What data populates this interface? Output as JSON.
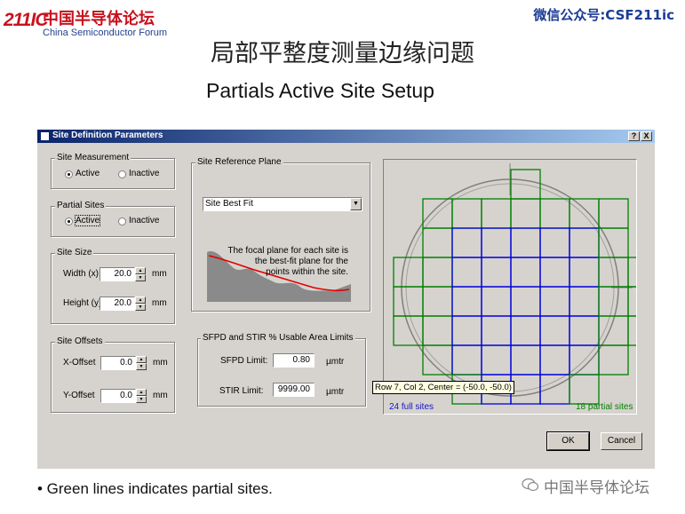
{
  "header": {
    "logo_mark": "211IC",
    "logo_cn": "中国半导体论坛",
    "logo_en": "China Semiconductor Forum",
    "wechat": "微信公众号:CSF211ic"
  },
  "slide": {
    "title_cn": "局部平整度测量边缘问题",
    "title_en": "Partials Active Site Setup",
    "bullet": "• Green lines indicates partial sites.",
    "watermark": "中国半导体论坛"
  },
  "dialog": {
    "title": "Site Definition Parameters",
    "help_btn": "?",
    "close_btn": "X",
    "site_measurement": {
      "legend": "Site Measurement",
      "active": "Active",
      "inactive": "Inactive",
      "selected": "active"
    },
    "partial_sites": {
      "legend": "Partial Sites",
      "active": "Active",
      "inactive": "Inactive",
      "selected": "active"
    },
    "site_size": {
      "legend": "Site Size",
      "width_label": "Width (x)",
      "width_value": "20.0",
      "height_label": "Height (y)",
      "height_value": "20.0",
      "unit": "mm"
    },
    "site_offsets": {
      "legend": "Site Offsets",
      "x_label": "X-Offset",
      "x_value": "0.0",
      "y_label": "Y-Offset",
      "y_value": "0.0",
      "unit": "mm"
    },
    "reference_plane": {
      "legend": "Site Reference Plane",
      "selected": "Site Best Fit",
      "desc_line1": "The focal plane for each site is",
      "desc_line2": "the best-fit plane for the",
      "desc_line3": "points within the site."
    },
    "limits": {
      "legend": "SFPD and STIR % Usable Area Limits",
      "sfpd_label": "SFPD Limit:",
      "sfpd_value": "0.80",
      "stir_label": "STIR Limit:",
      "stir_value": "9999.00",
      "unit": "µmtr"
    },
    "map": {
      "full_sites": "24 full sites",
      "partial_sites": "18 partial sites",
      "tooltip": "Row 7, Col 2, Center = (-50.0, -50.0)",
      "full_color": "#0000dd",
      "partial_color": "#008000"
    },
    "ok": "OK",
    "cancel": "Cancel"
  }
}
